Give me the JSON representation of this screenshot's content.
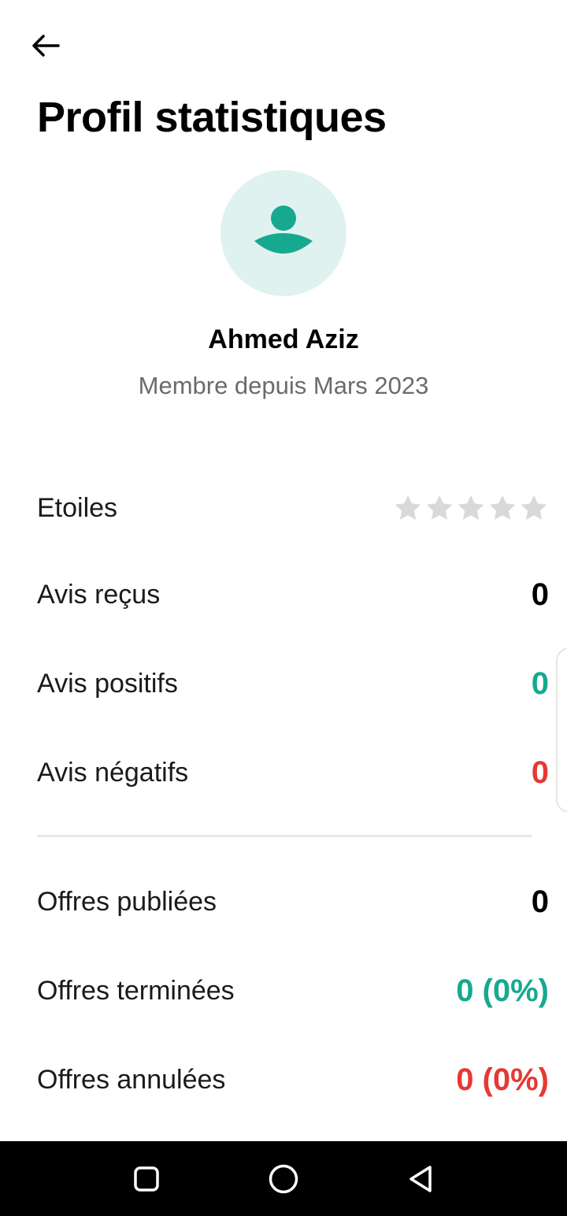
{
  "header": {
    "title": "Profil statistiques",
    "back_icon": "arrow-left-icon"
  },
  "profile": {
    "name": "Ahmed Aziz",
    "member_since": "Membre depuis Mars 2023",
    "avatar_icon": "user-icon",
    "avatar_bg": "#dff2ef",
    "avatar_fg": "#17a98f"
  },
  "stats": {
    "stars": {
      "label": "Etoiles",
      "rating": 0,
      "max": 5,
      "icon": "star-icon"
    },
    "reviews_received": {
      "label": "Avis reçus",
      "value": "0"
    },
    "reviews_positive": {
      "label": "Avis positifs",
      "value": "0"
    },
    "reviews_negative": {
      "label": "Avis négatifs",
      "value": "0"
    },
    "offers_published": {
      "label": "Offres publiées",
      "value": "0"
    },
    "offers_completed": {
      "label": "Offres terminées",
      "value": "0 (0%)"
    },
    "offers_cancelled": {
      "label": "Offres annulées",
      "value": "0 (0%)"
    }
  },
  "colors": {
    "positive": "#17a98f",
    "negative": "#e53935",
    "neutral": "#000000",
    "star_empty": "#d9d9d9"
  },
  "nav_bar": {
    "buttons": [
      "square-recents-icon",
      "circle-home-icon",
      "triangle-back-icon"
    ]
  }
}
